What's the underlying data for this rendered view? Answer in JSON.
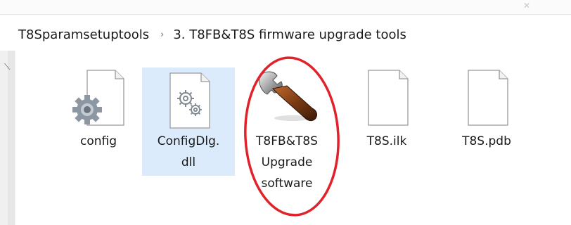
{
  "breadcrumb": {
    "items": [
      "T8Sparamsetuptools",
      "3. T8FB&T8S firmware upgrade tools"
    ],
    "separator": "›"
  },
  "files": [
    {
      "name": "config",
      "icon": "settings-file-icon"
    },
    {
      "name": "ConfigDlg.\ndll",
      "icon": "dll-gear-icon",
      "selected": true
    },
    {
      "name": "T8FB&T8S\nUpgrade\nsoftware",
      "icon": "wrench-icon"
    },
    {
      "name": "T8S.ilk",
      "icon": "blank-file-icon"
    },
    {
      "name": "T8S.pdb",
      "icon": "blank-file-icon"
    }
  ],
  "colors": {
    "selection": "#dcebfb",
    "annotation": "#e0232b"
  }
}
